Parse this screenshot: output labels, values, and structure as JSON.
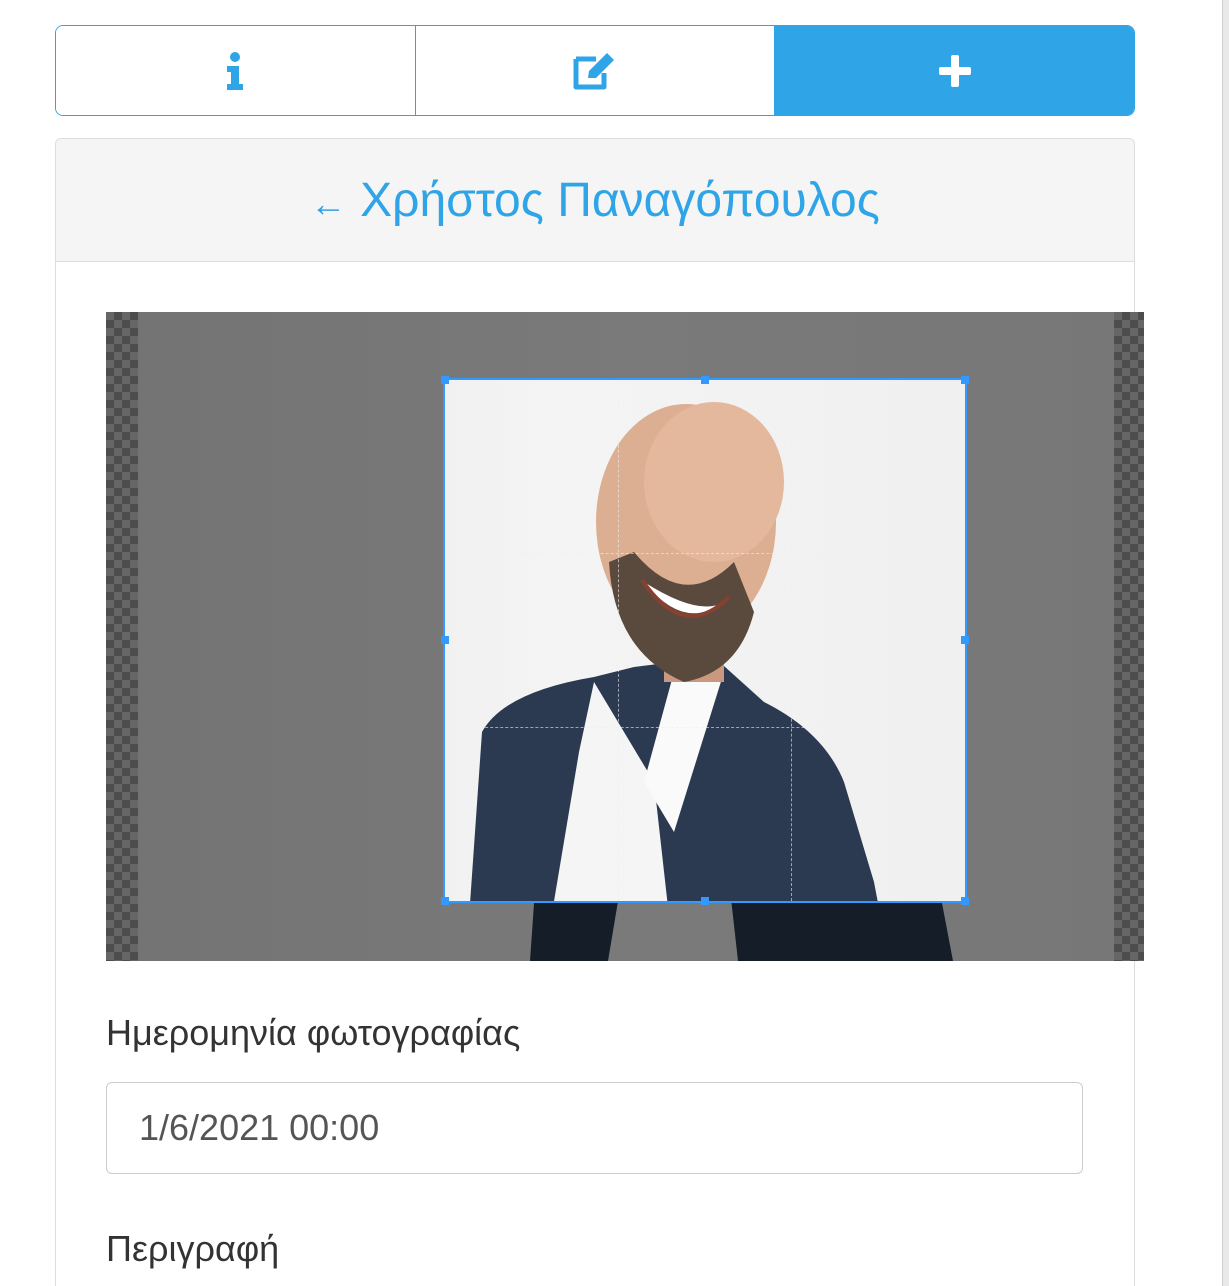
{
  "tabs": [
    {
      "icon": "info-icon",
      "active": false
    },
    {
      "icon": "edit-icon",
      "active": false
    },
    {
      "icon": "plus-icon",
      "active": true
    }
  ],
  "header": {
    "back_arrow": "←",
    "person_name": "Χρήστος Παναγόπουλος"
  },
  "form": {
    "date_label": "Ημερομηνία φωτογραφίας",
    "date_value": "1/6/2021 00:00",
    "description_label": "Περιγραφή"
  },
  "colors": {
    "accent": "#2fa4e7",
    "crop_outline": "#3399ff"
  }
}
